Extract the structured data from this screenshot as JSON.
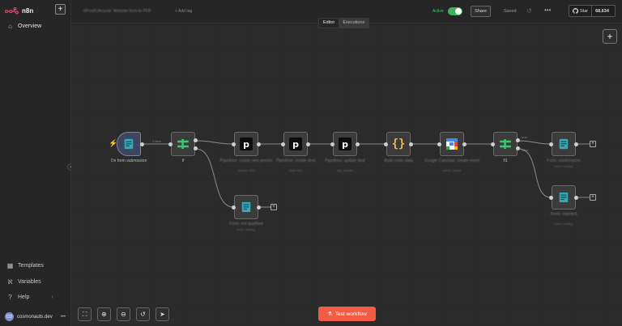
{
  "app": {
    "name": "n8n"
  },
  "sidebar": {
    "items": [
      {
        "label": "Overview",
        "icon": "home-icon"
      },
      {
        "label": "Templates",
        "icon": "templates-icon"
      },
      {
        "label": "Variables",
        "icon": "variables-icon"
      },
      {
        "label": "Help",
        "icon": "help-icon"
      }
    ],
    "user": {
      "name": "cosmonauts.dev",
      "initials": "CD"
    }
  },
  "header": {
    "workflow_name": "#Prod/Lifecycle: Website form-to-PDF",
    "add_tag": "+ Add tag",
    "active_label": "Active",
    "active": true,
    "share_label": "Share",
    "saved_label": "Saved",
    "github": {
      "star_label": "Star",
      "count": "68,634"
    }
  },
  "mode_tabs": [
    {
      "label": "Editor",
      "selected": true
    },
    {
      "label": "Executions",
      "selected": false
    }
  ],
  "nodes": [
    {
      "id": "form",
      "label": "On form submission",
      "sub": "",
      "icon": "form-icon"
    },
    {
      "id": "if1",
      "label": "If",
      "sub": "",
      "icon": "if-icon"
    },
    {
      "id": "p1",
      "label": "Pipedrive: create new person",
      "sub": "person: info",
      "icon": "pipedrive-icon"
    },
    {
      "id": "p2",
      "label": "Pipedrive: create deal",
      "sub": "deal: info",
      "icon": "pipedrive-icon"
    },
    {
      "id": "p3",
      "label": "Pipedrive: update deal",
      "sub": "org: update",
      "icon": "pipedrive-icon"
    },
    {
      "id": "code",
      "label": "Build invite data",
      "sub": "",
      "icon": "code-braces-icon"
    },
    {
      "id": "gcal",
      "label": "Google Calendar: create event",
      "sub": "event: create",
      "icon": "google-calendar-icon"
    },
    {
      "id": "if2",
      "label": "If1",
      "sub": "",
      "icon": "if-icon"
    },
    {
      "id": "f1",
      "label": "Form: confirmation",
      "sub": "form: ending",
      "icon": "form-icon"
    },
    {
      "id": "f2",
      "label": "Form: rejected",
      "sub": "form: ending",
      "icon": "form-icon"
    },
    {
      "id": "f3",
      "label": "Form: not qualified",
      "sub": "form: ending",
      "icon": "form-icon"
    }
  ],
  "edge_labels": {
    "trigger_items": "1 item",
    "if2_true": "true",
    "if2_false": "false"
  },
  "toolbar": {
    "test_workflow": "Test workflow"
  },
  "colors": {
    "accent": "#f15c45",
    "active_green": "#3fb15d",
    "canvas": "#2b2b2b"
  }
}
